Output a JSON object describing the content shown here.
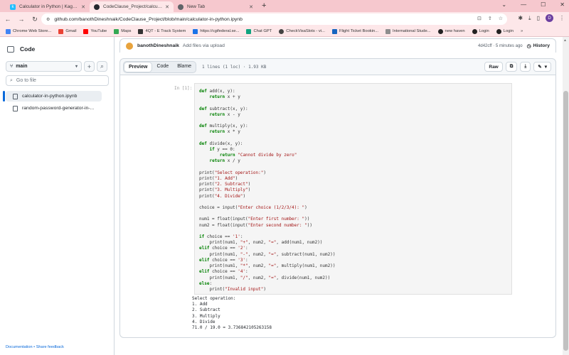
{
  "browser": {
    "tabs": [
      {
        "title": "Calculator in Python | Kaggle",
        "favicon_color": "#20beff",
        "favicon_letter": "k",
        "active": false
      },
      {
        "title": "CodeClause_Project/calculator-i",
        "favicon_color": "#24292f",
        "favicon_letter": "",
        "active": true
      },
      {
        "title": "New Tab",
        "favicon_color": "#5f6368",
        "favicon_letter": "",
        "active": false
      }
    ],
    "new_tab_symbol": "+",
    "window_controls": [
      "⌄",
      "—",
      "☐",
      "✕"
    ],
    "url": "github.com/banothDineshnaik/CodeClause_Project/blob/main/calculator-in-python.ipynb",
    "profile_letter": "D",
    "bookmarks": [
      {
        "label": "Chrome Web Store...",
        "color": "#4285f4"
      },
      {
        "label": "Gmail",
        "color": "#ea4335"
      },
      {
        "label": "YouTube",
        "color": "#ff0000"
      },
      {
        "label": "Maps",
        "color": "#34a853"
      },
      {
        "label": "4QT - E Track System",
        "color": "#333333"
      },
      {
        "label": "https://cgifederal.se...",
        "color": "#1a73e8"
      },
      {
        "label": "Chat GPT",
        "color": "#10a37f"
      },
      {
        "label": "CheckVisaSlots - vi...",
        "color": "#444444"
      },
      {
        "label": "Flight Ticket Bookin...",
        "color": "#1565c0"
      },
      {
        "label": "International Stude...",
        "color": "#8e8e8e"
      },
      {
        "label": "new haven",
        "color": "#222222"
      },
      {
        "label": "Login",
        "color": "#222222"
      },
      {
        "label": "Login",
        "color": "#222222"
      }
    ],
    "bookmarks_more": "»"
  },
  "sidebar": {
    "title": "Code",
    "branch": "main",
    "goto_placeholder": "Go to file",
    "files": [
      {
        "name": "calculator-in-python.ipynb",
        "selected": true
      },
      {
        "name": "random-password-generator-in-...",
        "selected": false
      }
    ],
    "footer": "Documentation • Share feedback"
  },
  "commit": {
    "author": "banothDineshnaik",
    "message": "Add files via upload",
    "meta": "4d42cff · 5 minutes ago",
    "history_label": "History"
  },
  "file_header": {
    "tabs": [
      "Preview",
      "Code",
      "Blame"
    ],
    "active_tab": "Preview",
    "stats": "1 lines (1 loc) · 1.93 KB",
    "raw_label": "Raw"
  },
  "notebook": {
    "prompt": "In [1]:",
    "code": "def add(x, y):\n    return x + y\n\ndef subtract(x, y):\n    return x - y\n\ndef multiply(x, y):\n    return x * y\n\ndef divide(x, y):\n    if y == 0:\n        return \"Cannot divide by zero\"\n    return x / y\n\nprint(\"Select operation:\")\nprint(\"1. Add\")\nprint(\"2. Subtract\")\nprint(\"3. Multiply\")\nprint(\"4. Divide\")\n\nchoice = input(\"Enter choice (1/2/3/4): \")\n\nnum1 = float(input(\"Enter first number: \"))\nnum2 = float(input(\"Enter second number: \"))\n\nif choice == '1':\n    print(num1, \"+\", num2, \"=\", add(num1, num2))\nelif choice == '2':\n    print(num1, \"-\", num2, \"=\", subtract(num1, num2))\nelif choice == '3':\n    print(num1, \"*\", num2, \"=\", multiply(num1, num2))\nelif choice == '4':\n    print(num1, \"/\", num2, \"=\", divide(num1, num2))\nelse:\n    print(\"Invalid input\")",
    "output": "Select operation:\n1. Add\n2. Subtract\n3. Multiply\n4. Divide\n71.0 / 19.0 = 3.736842105263158"
  },
  "colors": {
    "tabbar": "#f6c8ce",
    "toolbar": "#fde7e9",
    "link": "#0969da",
    "keyword": "#0000ff",
    "string": "#a31515"
  }
}
